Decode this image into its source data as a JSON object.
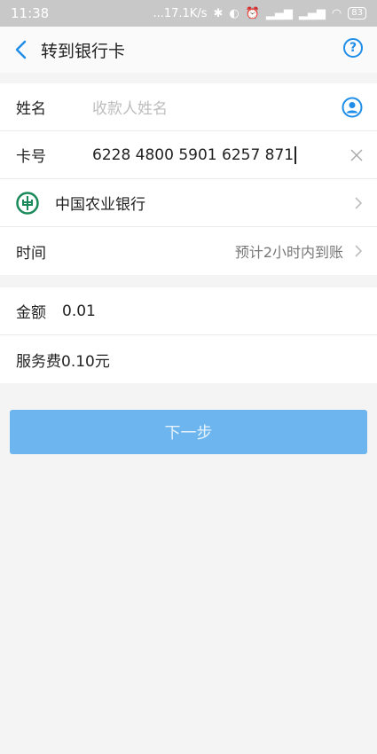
{
  "status_bar": {
    "time": "11:38",
    "net_speed": "...17.1K/s",
    "battery": "83"
  },
  "header": {
    "title": "转到银行卡"
  },
  "form": {
    "name_label": "姓名",
    "name_placeholder": "收款人姓名",
    "card_label": "卡号",
    "card_value": "6228 4800 5901 6257 871",
    "bank_name": "中国农业银行",
    "time_label": "时间",
    "time_value": "预计2小时内到账"
  },
  "amount": {
    "label": "金额",
    "value": "0.01",
    "fee": "服务费0.10元"
  },
  "actions": {
    "next_label": "下一步"
  },
  "colors": {
    "accent": "#1f8ee8",
    "button": "#6cb5ee",
    "bank_green": "#1a8a5a"
  }
}
